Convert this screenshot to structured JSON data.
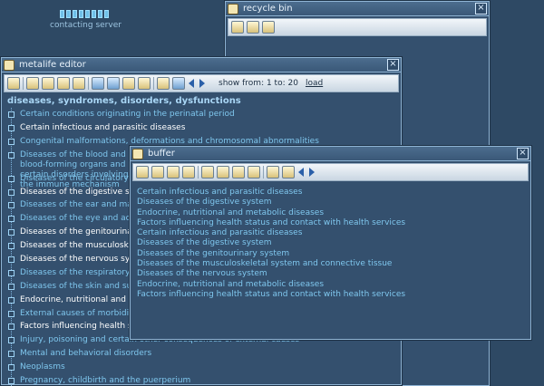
{
  "loader": {
    "status_text": "contacting server",
    "segments": 8
  },
  "recycle_bin": {
    "title": "recycle bin"
  },
  "editor": {
    "title": "metalife editor",
    "show_from_label": "show from: 1 to: 20",
    "load_link": "load",
    "section_heading": "diseases, syndromes, disorders, dysfunctions",
    "items": [
      {
        "label": "Certain conditions originating in the perinatal period",
        "selected": false
      },
      {
        "label": "Certain infectious and parasitic diseases",
        "selected": true
      },
      {
        "label": "Congenital malformations, deformations and chromosomal abnormalities",
        "selected": false
      },
      {
        "label": "Diseases of the blood and blood-forming organs and certain disorders involving the immune mechanism",
        "selected": false
      },
      {
        "label": "Diseases of the circulatory system",
        "selected": false
      },
      {
        "label": "Diseases of the digestive system",
        "selected": true
      },
      {
        "label": "Diseases of the ear and mastoid process",
        "selected": false
      },
      {
        "label": "Diseases of the eye and adnexa",
        "selected": false
      },
      {
        "label": "Diseases of the genitourinary system",
        "selected": true
      },
      {
        "label": "Diseases of the musculoskeletal system and connective tissue",
        "selected": true
      },
      {
        "label": "Diseases of the nervous system",
        "selected": true
      },
      {
        "label": "Diseases of the respiratory system",
        "selected": false
      },
      {
        "label": "Diseases of the skin and subcutaneous tissue",
        "selected": false
      },
      {
        "label": "Endocrine, nutritional and metabolic diseases",
        "selected": true
      },
      {
        "label": "External causes of morbidity and mortality",
        "selected": false
      },
      {
        "label": "Factors influencing health status and contact with health services",
        "selected": true
      },
      {
        "label": "Injury, poisoning and certain other consequences of external causes",
        "selected": false
      },
      {
        "label": "Mental and behavioral disorders",
        "selected": false
      },
      {
        "label": "Neoplasms",
        "selected": false
      },
      {
        "label": "Pregnancy, childbirth and the puerperium",
        "selected": false
      }
    ]
  },
  "buffer": {
    "title": "buffer",
    "items": [
      "Certain infectious and parasitic diseases",
      "Diseases of the digestive system",
      "Endocrine, nutritional and metabolic diseases",
      "Factors influencing health status and contact with health services",
      "Certain infectious and parasitic diseases",
      "Diseases of the digestive system",
      "Diseases of the genitourinary system",
      "Diseases of the musculoskeletal system and connective tissue",
      "Diseases of the nervous system",
      "Endocrine, nutritional and metabolic diseases",
      "Factors influencing health status and contact with health services"
    ]
  },
  "icons": {
    "window_close": "close-icon",
    "nav_prev": "arrow-left-icon",
    "nav_next": "arrow-right-icon"
  },
  "colors": {
    "desktop": "#2e4964",
    "list_text": "#7fc7ee",
    "selected_text": "#ffffff",
    "heading": "#a9d6f5"
  }
}
